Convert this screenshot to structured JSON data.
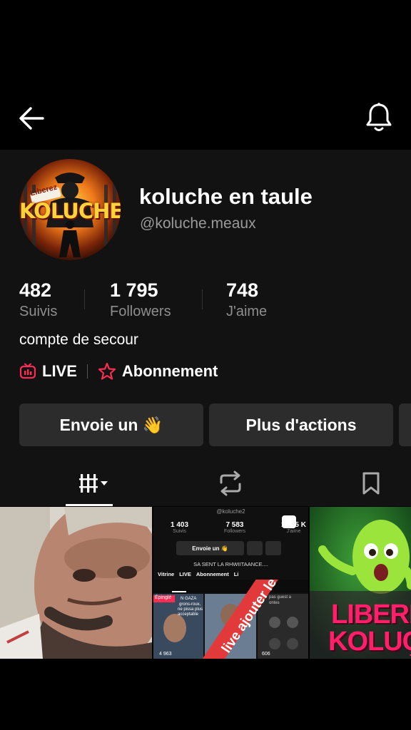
{
  "profile": {
    "name": "koluche en taule",
    "handle": "@koluche.meaux",
    "bio": "compte de secour",
    "avatar": {
      "top_word": "Liberez",
      "main_word": "KOLUCHE"
    }
  },
  "stats": [
    {
      "value": "482",
      "label": "Suivis"
    },
    {
      "value": "1 795",
      "label": "Followers"
    },
    {
      "value": "748",
      "label": "J'aime"
    }
  ],
  "links": {
    "live": "LIVE",
    "subscription": "Abonnement"
  },
  "actions": {
    "send_label": "Envoie un 👋",
    "more_label": "Plus d'actions"
  },
  "thumbnails": {
    "second": {
      "handle": "@koluche2",
      "stats": [
        {
          "value": "1 403",
          "label": "Suivis"
        },
        {
          "value": "7 583",
          "label": "Followers"
        },
        {
          "value": "132,5 K",
          "label": "J'aime"
        }
      ],
      "send_label": "Envoie un 👋",
      "bio": "SA SENT LA RHWIITAANCE....",
      "links": [
        "Vitrine",
        "LIVE",
        "Abonnement",
        "Li"
      ],
      "pinned": "Épinglé",
      "overlay_text": "live ajouter le",
      "small_texts": [
        "N GAZA",
        "grons-roux,",
        "ne pissa plus",
        "acceptable",
        "pas guest a",
        "ontes"
      ],
      "view_counts": [
        "4 963",
        "606"
      ]
    },
    "third": {
      "text_line1": "LIBERE",
      "text_line2": "KOLUÇ"
    }
  },
  "colors": {
    "accent": "#fe2c55",
    "background": "#121212",
    "button": "#2c2c2c",
    "secondary_text": "#8e8e8e"
  }
}
